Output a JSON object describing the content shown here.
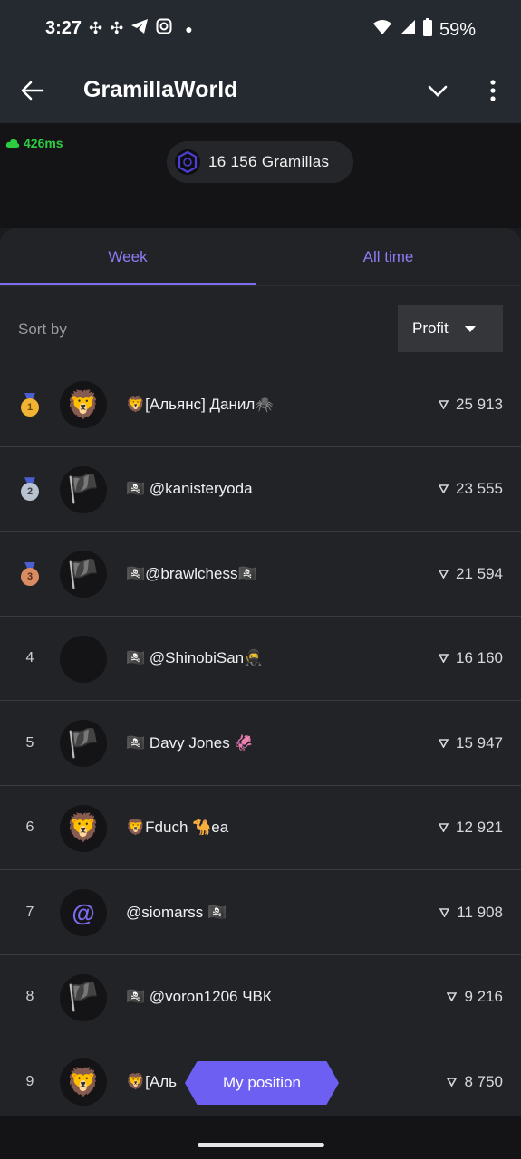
{
  "status": {
    "time": "3:27",
    "battery": "59%"
  },
  "app": {
    "title": "GramillaWorld"
  },
  "ping": "426ms",
  "gramillas": "16 156 Gramillas",
  "tabs": [
    {
      "label": "Week"
    },
    {
      "label": "All time"
    }
  ],
  "sort": {
    "label": "Sort by",
    "value": "Profit"
  },
  "rows": [
    {
      "rank": "1",
      "name": "🦁[Альянс] Данил🕷️",
      "score": "25 913",
      "avatar": "🦁"
    },
    {
      "rank": "2",
      "name": "🏴‍☠️ @kanisteryoda",
      "score": "23 555",
      "avatar": "🏴"
    },
    {
      "rank": "3",
      "name": "🏴‍☠️@brawlchess🏴‍☠️",
      "score": "21 594",
      "avatar": "🏴"
    },
    {
      "rank": "4",
      "name": "🏴‍☠️ @ShinobiSan🥷",
      "score": "16 160",
      "avatar": ""
    },
    {
      "rank": "5",
      "name": "🏴‍☠️ Davy Jones 🦑",
      "score": "15 947",
      "avatar": "🏴"
    },
    {
      "rank": "6",
      "name": "🦁Fduch 🐪ea",
      "score": "12 921",
      "avatar": "🦁"
    },
    {
      "rank": "7",
      "name": "@siomarss 🏴‍☠️",
      "score": "11 908",
      "avatar": "@"
    },
    {
      "rank": "8",
      "name": "🏴‍☠️ @voron1206 ЧВК",
      "score": "9 216",
      "avatar": "🏴"
    },
    {
      "rank": "9",
      "name": "🦁[Аль",
      "score": "8 750",
      "avatar": "🦁"
    }
  ],
  "my_position": "My position",
  "colors": {
    "accent": "#7b6cf0",
    "ping": "#2ecc40",
    "gold": "#f2b233",
    "silver": "#b9c2cf",
    "bronze": "#d98b62"
  }
}
